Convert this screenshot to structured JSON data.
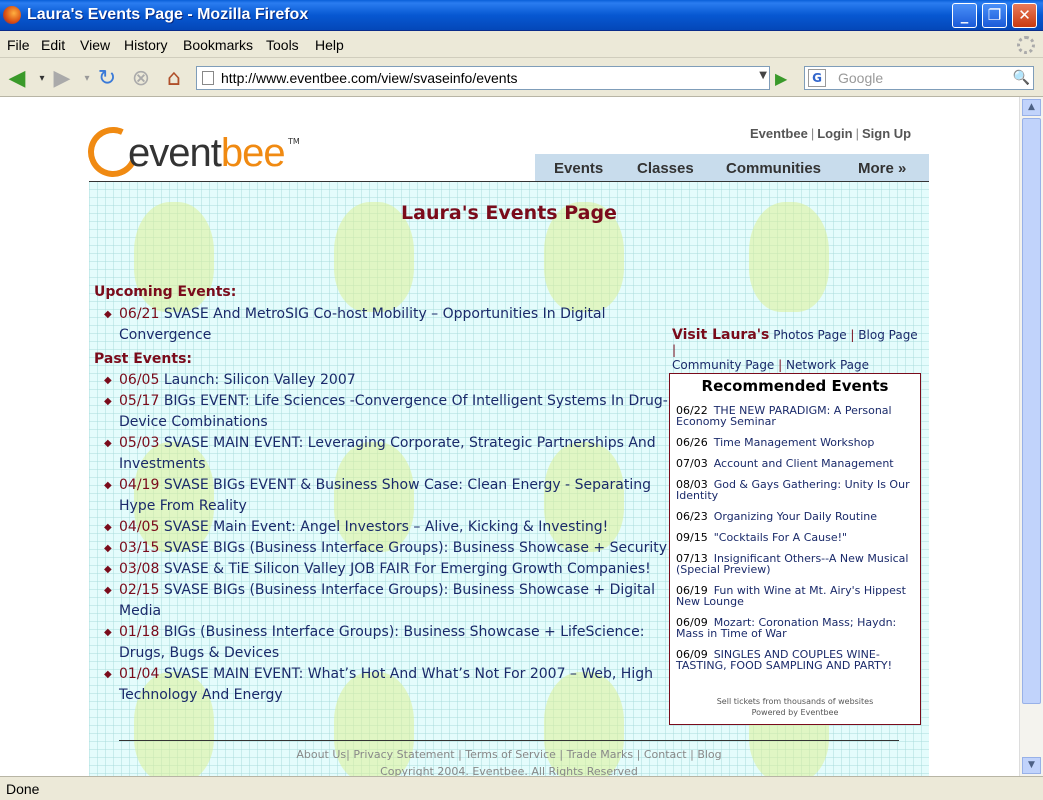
{
  "window": {
    "title": "Laura's Events Page - Mozilla Firefox"
  },
  "menu": [
    "File",
    "Edit",
    "View",
    "History",
    "Bookmarks",
    "Tools",
    "Help"
  ],
  "toolbar": {
    "url": "http://www.eventbee.com/view/svaseinfo/events",
    "search_placeholder": "Google",
    "search_engine_letter": "G"
  },
  "site": {
    "logo_text_a": "event",
    "logo_text_b": "bee",
    "logo_tm": "TM",
    "toplinks": [
      "Eventbee",
      "Login",
      "Sign Up"
    ],
    "tabs": [
      "Events",
      "Classes",
      "Communities",
      "More »"
    ]
  },
  "page": {
    "title": "Laura's Events Page",
    "upcoming_label": "Upcoming Events:",
    "past_label": "Past Events:",
    "upcoming": [
      {
        "date": "06/21",
        "title": "SVASE And MetroSIG Co-host Mobility – Opportunities In Digital Convergence"
      }
    ],
    "past": [
      {
        "date": "06/05",
        "title": "Launch: Silicon Valley 2007"
      },
      {
        "date": "05/17",
        "title": "BIGs EVENT: Life Sciences -Convergence Of Intelligent Systems In Drug-Device Combinations"
      },
      {
        "date": "05/03",
        "title": "SVASE MAIN EVENT: Leveraging Corporate, Strategic Partnerships And Investments"
      },
      {
        "date": "04/19",
        "title": "SVASE BIGs EVENT & Business Show Case: Clean Energy - Separating Hype From Reality"
      },
      {
        "date": "04/05",
        "title": "SVASE Main Event: Angel Investors – Alive, Kicking & Investing!"
      },
      {
        "date": "03/15",
        "title": "SVASE BIGs (Business Interface Groups): Business Showcase + Security"
      },
      {
        "date": "03/08",
        "title": "SVASE & TiE Silicon Valley JOB FAIR For Emerging Growth Companies!"
      },
      {
        "date": "02/15",
        "title": "SVASE BIGs (Business Interface Groups): Business Showcase + Digital Media"
      },
      {
        "date": "01/18",
        "title": "BIGs (Business Interface Groups): Business Showcase + LifeScience: Drugs, Bugs & Devices"
      },
      {
        "date": "01/04",
        "title": "SVASE MAIN EVENT: What’s Hot And What’s Not For 2007 – Web, High Technology And Energy"
      }
    ],
    "visit": {
      "label": "Visit Laura's",
      "links": [
        "Photos Page",
        "Blog Page",
        "Community Page",
        "Network Page"
      ]
    },
    "recommended": {
      "title": "Recommended Events",
      "items": [
        {
          "date": "06/22",
          "title": "THE NEW PARADIGM: A Personal Economy Seminar"
        },
        {
          "date": "06/26",
          "title": "Time Management Workshop"
        },
        {
          "date": "07/03",
          "title": "Account and Client Management"
        },
        {
          "date": "08/03",
          "title": "God & Gays Gathering: Unity Is Our Identity"
        },
        {
          "date": "06/23",
          "title": "Organizing Your Daily Routine"
        },
        {
          "date": "09/15",
          "title": "\"Cocktails For A Cause!\""
        },
        {
          "date": "07/13",
          "title": "Insignificant Others--A New Musical (Special Preview)"
        },
        {
          "date": "06/19",
          "title": "Fun with Wine at Mt. Airy's Hippest New Lounge"
        },
        {
          "date": "06/09",
          "title": "Mozart: Coronation Mass; Haydn: Mass in Time of War"
        },
        {
          "date": "06/09",
          "title": "SINGLES AND COUPLES WINE-TASTING, FOOD SAMPLING AND PARTY!"
        }
      ],
      "foot_line1": "Sell tickets from thousands of websites",
      "foot_line2": "Powered by Eventbee"
    },
    "footer": {
      "links": [
        "About Us",
        "Privacy Statement",
        "Terms of Service",
        "Trade Marks",
        "Contact",
        "Blog"
      ],
      "copyright": "Copyright 2004. Eventbee. All Rights Reserved"
    }
  },
  "status": {
    "text": "Done"
  }
}
